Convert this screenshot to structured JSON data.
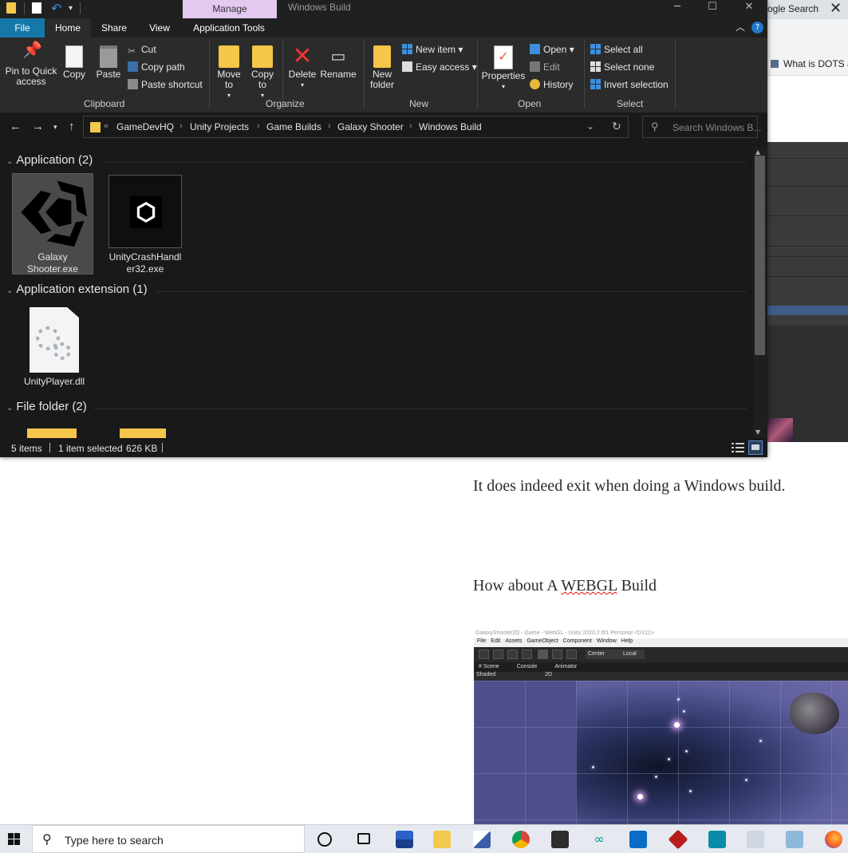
{
  "background_browser": {
    "tab_title": "ogle Search",
    "close_glyph": "✕",
    "bookmark_text": "What is DOTS an",
    "article": {
      "paragraph1": "It does indeed exit when doing a Windows build.",
      "paragraph2_pre": "How about A ",
      "paragraph2_squiggle": "WEBGL",
      "paragraph2_post": " Build"
    },
    "unity_screenshot": {
      "title": "GalaxyShooter2D - Game - WebGL - Unity 2020.2.6f1 Personal <DX11>",
      "menu": [
        "File",
        "Edit",
        "Assets",
        "GameObject",
        "Component",
        "Window",
        "Help"
      ],
      "toolbar_center": "Center",
      "toolbar_local": "Local",
      "tabs": [
        "# Scene",
        "Console",
        "Animator"
      ],
      "shading": "Shaded",
      "mode_2d": "2D"
    }
  },
  "explorer": {
    "manage_tab": "Manage",
    "window_title": "Windows Build",
    "window_controls": {
      "minimize": "─",
      "maximize": "☐",
      "close": "✕"
    },
    "ribbon_tabs": [
      "File",
      "Home",
      "Share",
      "View",
      "Application Tools"
    ],
    "ribbon": {
      "clipboard": {
        "label": "Clipboard",
        "pin": "Pin to Quick access",
        "copy": "Copy",
        "paste": "Paste",
        "cut": "Cut",
        "copy_path": "Copy path",
        "paste_shortcut": "Paste shortcut"
      },
      "organize": {
        "label": "Organize",
        "move_to": "Move to",
        "copy_to": "Copy to",
        "delete": "Delete",
        "rename": "Rename"
      },
      "new": {
        "label": "New",
        "new_folder": "New folder",
        "new_item": "New item",
        "easy_access": "Easy access"
      },
      "open": {
        "label": "Open",
        "properties": "Properties",
        "open": "Open",
        "edit": "Edit",
        "history": "History"
      },
      "select": {
        "label": "Select",
        "select_all": "Select all",
        "select_none": "Select none",
        "invert_selection": "Invert selection"
      }
    },
    "address": {
      "breadcrumbs": [
        "GameDevHQ",
        "Unity Projects",
        "Game Builds",
        "Galaxy Shooter",
        "Windows Build"
      ],
      "search_placeholder": "Search Windows B..."
    },
    "groups": [
      {
        "title": "Application (2)",
        "items": [
          "Galaxy Shooter.exe",
          "UnityCrashHandler32.exe"
        ]
      },
      {
        "title": "Application extension (1)",
        "items": [
          "UnityPlayer.dll"
        ]
      },
      {
        "title": "File folder (2)",
        "items": []
      }
    ],
    "item_labels": {
      "galaxy": "Galaxy Shooter.exe",
      "crash": "UnityCrashHandler32.exe",
      "dll": "UnityPlayer.dll"
    },
    "status": {
      "items": "5 items",
      "selected": "1 item selected",
      "size": "626 KB"
    }
  },
  "taskbar": {
    "search_placeholder": "Type here to search",
    "apps": [
      "cortana-icon",
      "task-view-icon",
      "tetris-icon",
      "file-explorer-icon",
      "paint-icon",
      "chrome-icon",
      "store-icon",
      "arduino-icon",
      "mail-icon",
      "game-icon",
      "vscode-icon",
      "photos-icon",
      "notepad-icon",
      "firefox-icon"
    ]
  },
  "colors": {
    "explorer_bg": "#191919",
    "ribbon_bg": "#2b2b2b",
    "file_tab": "#1578a8",
    "manage_tab": "#e3c8f0",
    "folder_yellow": "#f4c64a",
    "taskbar_bg": "#e6eaf0"
  }
}
